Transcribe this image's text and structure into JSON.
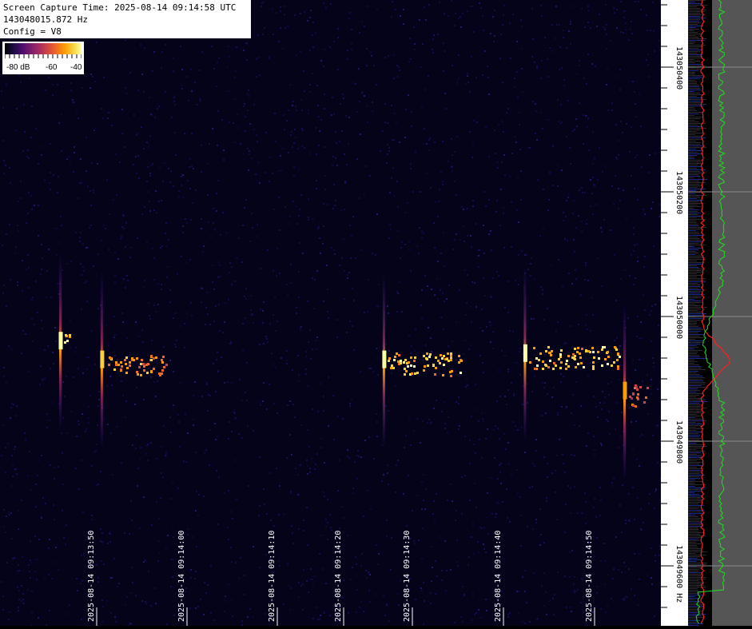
{
  "header": {
    "line1": "Screen Capture Time: 2025-08-14 09:14:58 UTC",
    "line2": "143048015.872 Hz",
    "line3": "Config = V8"
  },
  "legend": {
    "labels": [
      "-80 dB",
      "-60",
      "-40"
    ],
    "colormap": "inferno"
  },
  "colors": {
    "background": "#05031a",
    "red_trace": "#ff2020",
    "green_trace": "#20e020",
    "spectrum_bg": "#555555"
  },
  "chart_data": {
    "type": "heatmap",
    "title": "",
    "xlabel": "",
    "ylabel": "Hz",
    "time_ticks": [
      "2025-08-14 09:13:50",
      "2025-08-14 09:14:00",
      "2025-08-14 09:14:10",
      "2025-08-14 09:14:20",
      "2025-08-14 09:14:30",
      "2025-08-14 09:14:40",
      "2025-08-14 09:14:50"
    ],
    "freq_ticks": [
      "143050400",
      "143050200",
      "143050000",
      "143049800",
      "143049600 Hz"
    ],
    "freq_unit": "Hz",
    "zlim_db": [
      -80,
      -40
    ],
    "events": [
      {
        "time": "09:13:46",
        "freq_hz": 143049960,
        "intensity_db": -40
      },
      {
        "time": "09:13:51",
        "freq_hz": 143049930,
        "intensity_db": -45
      },
      {
        "time": "09:14:25",
        "freq_hz": 143049930,
        "intensity_db": -40
      },
      {
        "time": "09:14:42",
        "freq_hz": 143049940,
        "intensity_db": -40
      },
      {
        "time": "09:14:54",
        "freq_hz": 143049880,
        "intensity_db": -50
      }
    ]
  }
}
